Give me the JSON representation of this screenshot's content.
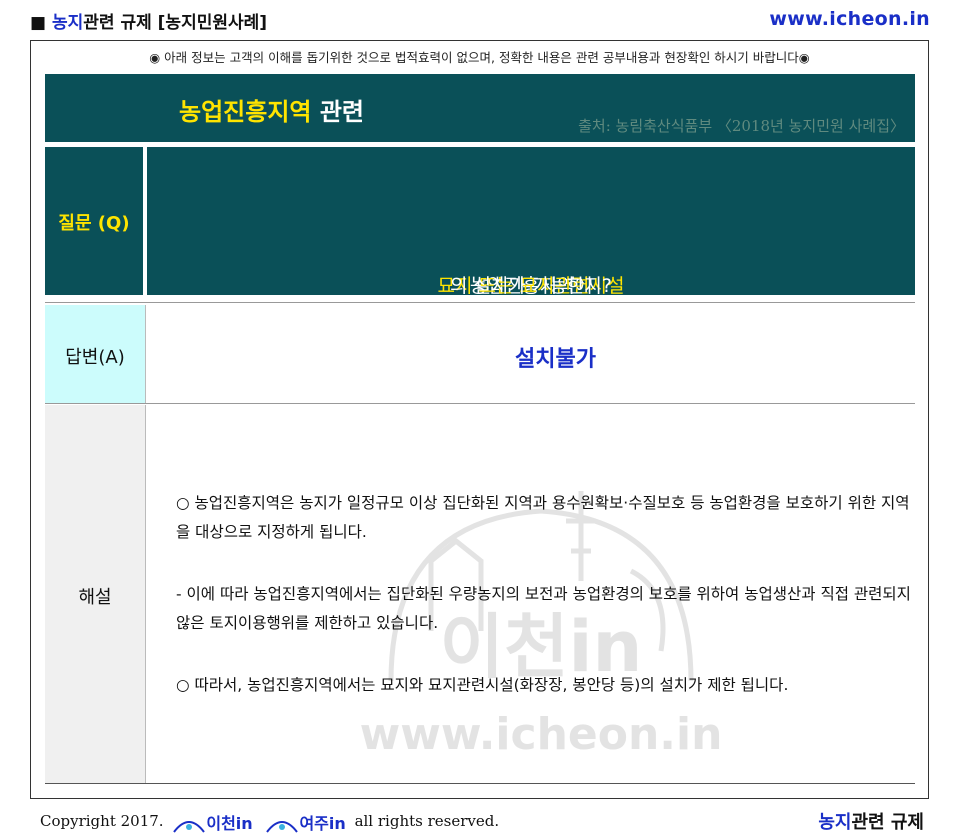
{
  "top": {
    "marker": "■ ",
    "title_blue": "농지",
    "title_rest": "관련 규제 [농지민원사례]",
    "site": "www.icheon.in"
  },
  "notice": "◉ 아래 정보는 고객의 이해를 돕기위한 것으로 법적효력이 없으며, 정확한 내용은 관련 공부내용과 현장확인 하시기 바랍니다◉",
  "header": {
    "title_yellow": "농업진흥지역",
    "title_white": " 관련",
    "source": "출처: 농림축산식품부 〈2018년 농지민원 사례집〉"
  },
  "question": {
    "label": "질문 (Q)",
    "text_before": "농업진흥지역에 ",
    "text_highlight": "묘지 또는 묘지관련시설",
    "text_after": "의 설치가 가능한지?"
  },
  "answer": {
    "label": "답변(A)",
    "text": "설치불가"
  },
  "explanation": {
    "label": "해설",
    "paragraphs": [
      "○ 농업진흥지역은 농지가 일정규모 이상 집단화된 지역과 용수원확보·수질보호 등 농업환경을 보호하기 위한 지역을 대상으로 지정하게 됩니다.",
      "- 이에 따라 농업진흥지역에서는 집단화된 우량농지의 보전과 농업환경의 보호를 위하여 농업생산과 직접 관련되지 않은 토지이용행위를 제한하고 있습니다.",
      "○ 따라서, 농업진흥지역에서는 묘지와 묘지관련시설(화장장, 봉안당 등)의 설치가 제한 됩니다."
    ]
  },
  "watermark": {
    "logo_text": "이천in",
    "url": "www.icheon.in"
  },
  "footer": {
    "copyright": "Copyright 2017.",
    "brand1": "이천in",
    "brand2": "여주in",
    "rights": "all rights reserved.",
    "right_blue": "농지",
    "right_rest": "관련 규제"
  },
  "colors": {
    "teal": "#0a5058",
    "yellow": "#ffe400",
    "blue": "#1a2fc7",
    "answer_bg": "#ccfcfc"
  }
}
